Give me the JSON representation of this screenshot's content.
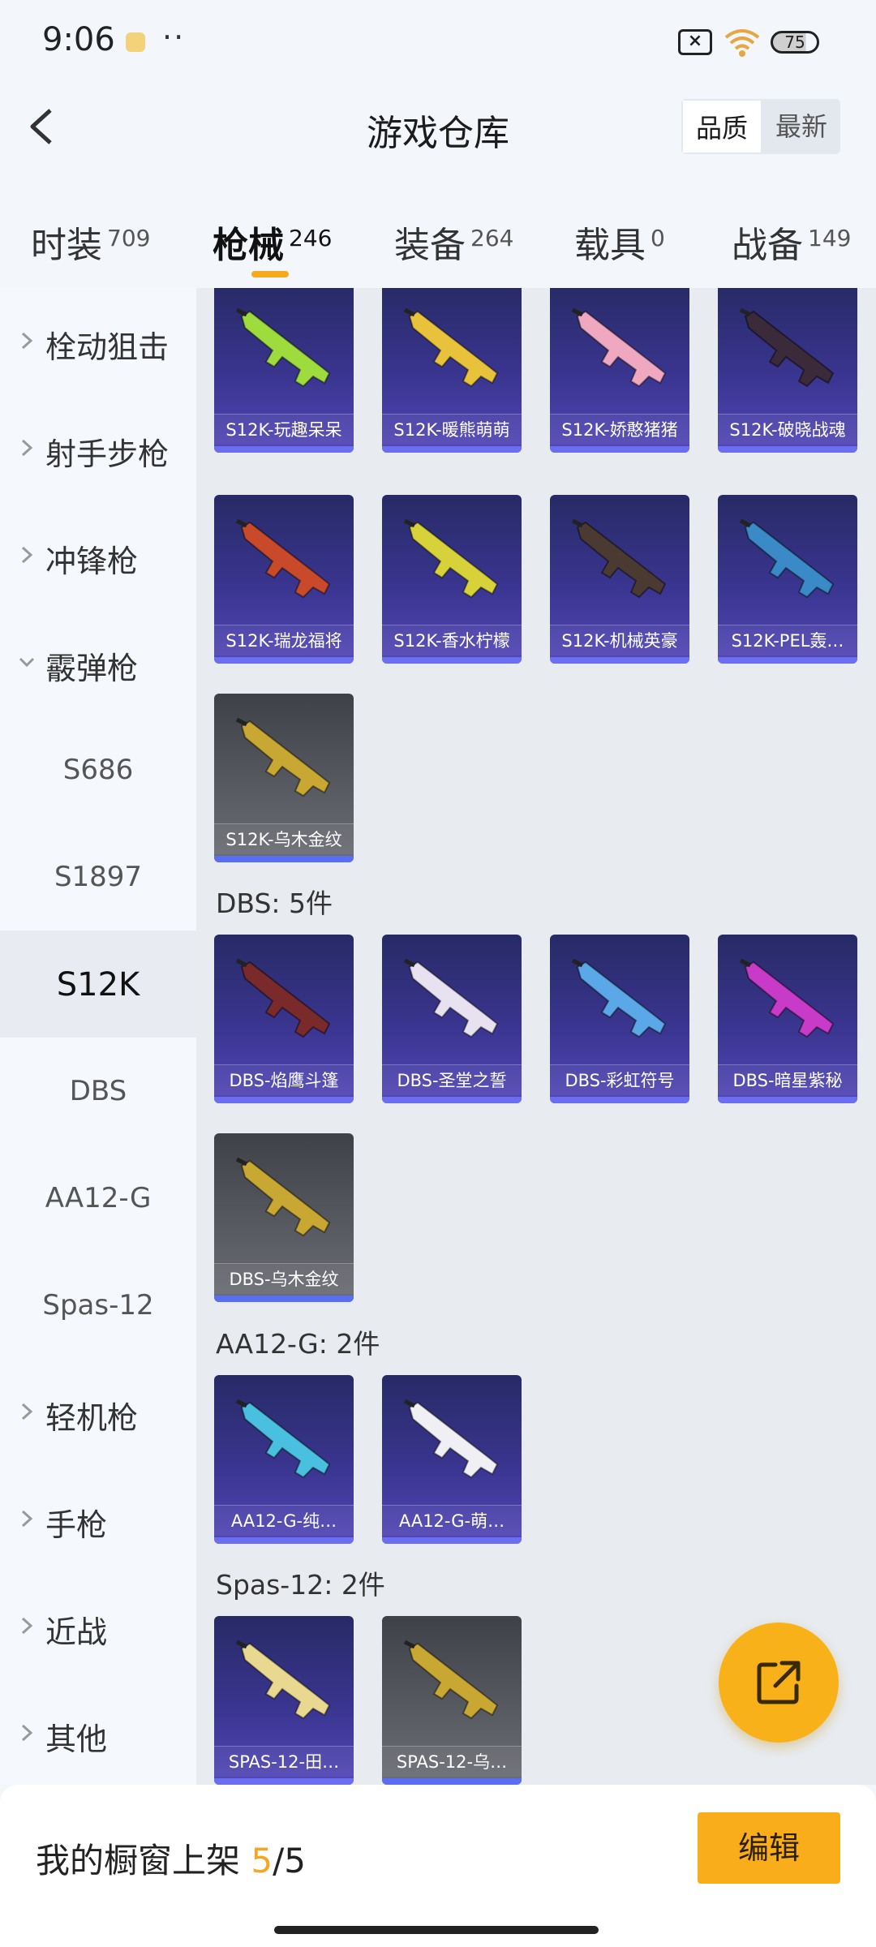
{
  "status": {
    "time": "9:06",
    "battery": "75"
  },
  "header": {
    "title": "游戏仓库",
    "sort_options": [
      "品质",
      "最新"
    ]
  },
  "tabs": [
    {
      "label": "时装",
      "count": "709"
    },
    {
      "label": "枪械",
      "count": "246"
    },
    {
      "label": "装备",
      "count": "264"
    },
    {
      "label": "载具",
      "count": "0"
    },
    {
      "label": "战备",
      "count": "149"
    }
  ],
  "sidebar": {
    "items": [
      {
        "label": "栓动狙击"
      },
      {
        "label": "射手步枪"
      },
      {
        "label": "冲锋枪"
      },
      {
        "label": "霰弹枪"
      },
      {
        "label": "S686"
      },
      {
        "label": "S1897"
      },
      {
        "label": "S12K"
      },
      {
        "label": "DBS"
      },
      {
        "label": "AA12-G"
      },
      {
        "label": "Spas-12"
      },
      {
        "label": "轻机枪"
      },
      {
        "label": "手枪"
      },
      {
        "label": "近战"
      },
      {
        "label": "其他"
      }
    ]
  },
  "groups": {
    "dbs": "DBS: 5件",
    "aa12": "AA12-G: 2件",
    "spas": "Spas-12: 2件"
  },
  "cards": {
    "s12k": [
      {
        "name": "S12K-玩趣呆呆",
        "gun_color": "#9ddc3c"
      },
      {
        "name": "S12K-暖熊萌萌",
        "gun_color": "#e8c23a"
      },
      {
        "name": "S12K-娇憨猪猪",
        "gun_color": "#f0a8c0"
      },
      {
        "name": "S12K-破晓战魂",
        "gun_color": "#3a2a3a"
      },
      {
        "name": "S12K-瑞龙福将",
        "gun_color": "#c84a2a"
      },
      {
        "name": "S12K-香水柠檬",
        "gun_color": "#d8d23a"
      },
      {
        "name": "S12K-机械英豪",
        "gun_color": "#4a3a32"
      },
      {
        "name": "S12K-PEL轰…",
        "gun_color": "#3a8ac8"
      },
      {
        "name": "S12K-乌木金纹",
        "gun_color": "#c8a832"
      }
    ],
    "dbs": [
      {
        "name": "DBS-焰鹰斗篷",
        "gun_color": "#7a2a2a"
      },
      {
        "name": "DBS-圣堂之誓",
        "gun_color": "#e8e2f0"
      },
      {
        "name": "DBS-彩虹符号",
        "gun_color": "#5aa8e8"
      },
      {
        "name": "DBS-暗星紫秘",
        "gun_color": "#c83ac8"
      },
      {
        "name": "DBS-乌木金纹",
        "gun_color": "#c8a832"
      }
    ],
    "aa12": [
      {
        "name": "AA12-G-纯…",
        "gun_color": "#4ac0e0"
      },
      {
        "name": "AA12-G-萌…",
        "gun_color": "#f0f0f4"
      }
    ],
    "spas": [
      {
        "name": "SPAS-12-田…",
        "gun_color": "#e8d890"
      },
      {
        "name": "SPAS-12-乌…",
        "gun_color": "#c8a832"
      }
    ]
  },
  "bottom": {
    "shelf_label": "我的橱窗上架",
    "shelf_count": "5",
    "shelf_total": "/5",
    "edit_label": "编辑"
  }
}
